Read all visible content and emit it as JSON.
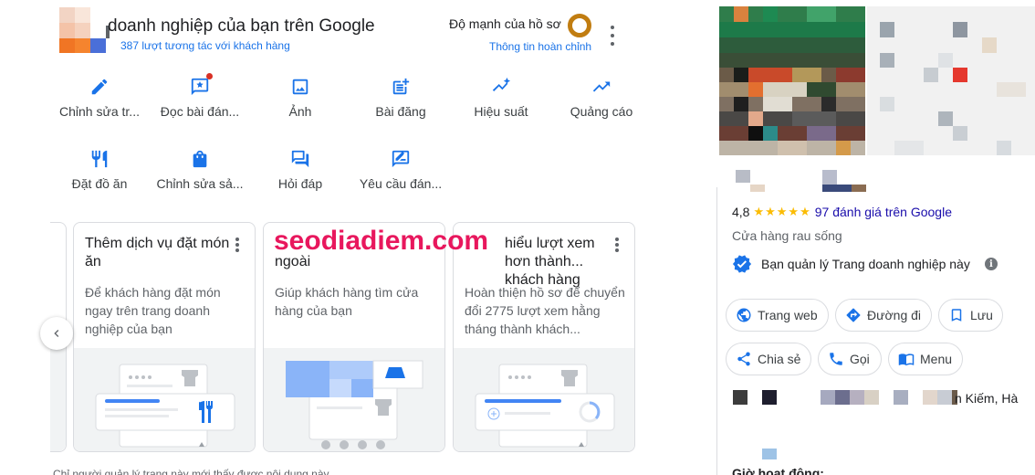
{
  "header": {
    "title": "doanh nghiệp của bạn trên Google",
    "interactions": "387 lượt tương tác với khách hàng",
    "strength_label": "Độ mạnh của hồ sơ",
    "profile_complete": "Thông tin hoàn chỉnh"
  },
  "actions": [
    {
      "label": "Chỉnh sửa tr...",
      "icon": "pencil-icon"
    },
    {
      "label": "Đọc bài đán...",
      "icon": "star-review-icon"
    },
    {
      "label": "Ảnh",
      "icon": "photo-icon"
    },
    {
      "label": "Bài đăng",
      "icon": "post-icon"
    },
    {
      "label": "Hiệu suất",
      "icon": "performance-icon"
    },
    {
      "label": "Quảng cáo",
      "icon": "trending-up-icon"
    },
    {
      "label": "Đặt đồ ăn",
      "icon": "restaurant-icon"
    },
    {
      "label": "Chỉnh sửa sả...",
      "icon": "shopping-bag-icon"
    },
    {
      "label": "Hỏi đáp",
      "icon": "forum-icon"
    },
    {
      "label": "Yêu cầu đán...",
      "icon": "rate-review-icon"
    }
  ],
  "cards": [
    {
      "title": "Thêm dịch vụ đặt món ăn",
      "desc": "Để khách hàng đặt món ngay trên trang doanh nghiệp của bạn"
    },
    {
      "title": "ngoài",
      "desc": "Giúp khách hàng tìm cửa hàng của bạn"
    },
    {
      "title": "hiểu lượt xem hơn thành... khách hàng",
      "desc": "Hoàn thiện hồ sơ để chuyển đổi 2775 lượt xem hằng tháng thành khách..."
    }
  ],
  "watermark": "seodiadiem.com",
  "footnote": "Chỉ người quản lý trang này mới thấy được nội dung này",
  "panel": {
    "rating": "4,8",
    "stars": "★★★★★",
    "reviews": "97 đánh giá trên Google",
    "category": "Cửa hàng rau sống",
    "managed": "Bạn quản lý Trang doanh nghiệp này",
    "info_glyph": "i",
    "buttons": {
      "website": "Trang web",
      "directions": "Đường đi",
      "save": "Lưu",
      "share": "Chia sẻ",
      "call": "Gọi",
      "menu": "Menu"
    },
    "address_fragment": "n Kiếm, Hà",
    "hours_label": "Giờ hoạt động:"
  },
  "colors": {
    "link_blue": "#1a73e8",
    "review_link": "#1a0dab",
    "star_yellow": "#fbbc04",
    "watermark_pink": "#e8175d",
    "strength_ring": "#c17d11"
  }
}
